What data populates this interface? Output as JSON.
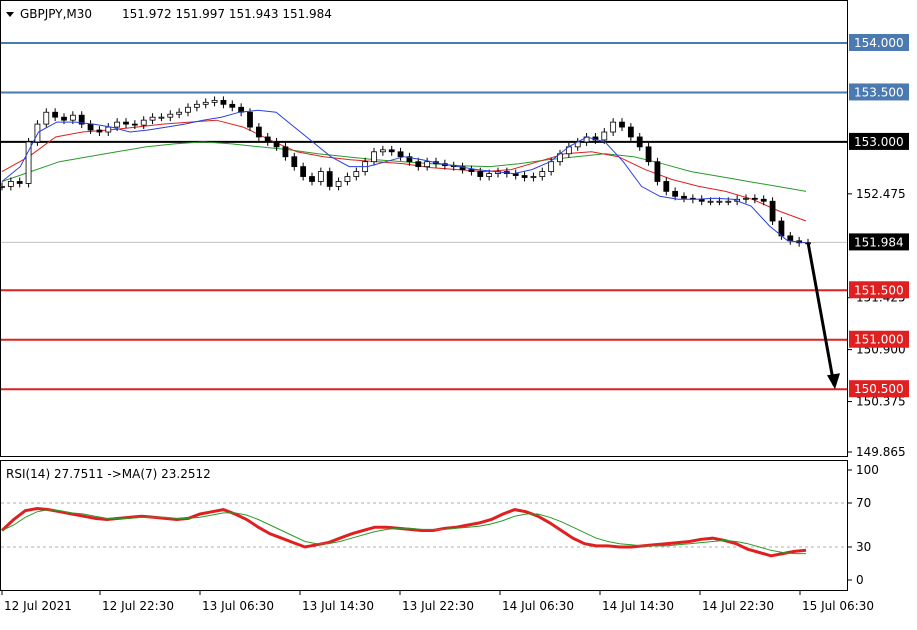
{
  "header": {
    "symbol_label": "GBPJPY,M30",
    "ohlc": "151.972 151.997 151.943 151.984",
    "rsi_label": "RSI(14) 27.7511 ->MA(7) 23.2512"
  },
  "chart_data": {
    "type": "candlestick",
    "symbol": "GBPJPY",
    "timeframe": "M30",
    "open": 151.972,
    "high": 151.997,
    "low": 151.943,
    "close": 151.984,
    "price_ylim": [
      149.75,
      154.25
    ],
    "price_ticks": [
      "154.000",
      "153.500",
      "153.000",
      "152.475",
      "151.984",
      "151.425",
      "150.900",
      "150.375",
      "149.865"
    ],
    "x_ticks": [
      "12 Jul 2021",
      "12 Jul 22:30",
      "13 Jul 06:30",
      "13 Jul 14:30",
      "13 Jul 22:30",
      "14 Jul 06:30",
      "14 Jul 14:30",
      "14 Jul 22:30",
      "15 Jul 06:30"
    ],
    "levels": [
      {
        "label": "154.000",
        "value": 154.0,
        "color": "#4a7ab0",
        "kind": "resistance"
      },
      {
        "label": "153.500",
        "value": 153.5,
        "color": "#4a7ab0",
        "kind": "resistance"
      },
      {
        "label": "153.000",
        "value": 153.0,
        "color": "#000000",
        "kind": "pivot"
      },
      {
        "label": "151.984",
        "value": 151.984,
        "color": "#c0c0c0",
        "kind": "current"
      },
      {
        "label": "151.500",
        "value": 151.5,
        "color": "#e02020",
        "kind": "support"
      },
      {
        "label": "151.000",
        "value": 151.0,
        "color": "#e02020",
        "kind": "support"
      },
      {
        "label": "150.500",
        "value": 150.5,
        "color": "#e02020",
        "kind": "support"
      }
    ],
    "close_series": [
      152.55,
      152.6,
      152.58,
      153.0,
      153.18,
      153.3,
      153.25,
      153.22,
      153.27,
      153.18,
      153.12,
      153.1,
      153.15,
      153.2,
      153.18,
      153.17,
      153.22,
      153.25,
      153.25,
      153.28,
      153.3,
      153.35,
      153.38,
      153.4,
      153.42,
      153.38,
      153.35,
      153.3,
      153.15,
      153.05,
      153.0,
      152.95,
      152.85,
      152.75,
      152.65,
      152.6,
      152.7,
      152.55,
      152.6,
      152.65,
      152.7,
      152.8,
      152.9,
      152.92,
      152.9,
      152.85,
      152.8,
      152.75,
      152.8,
      152.78,
      152.76,
      152.75,
      152.72,
      152.7,
      152.65,
      152.68,
      152.7,
      152.68,
      152.66,
      152.64,
      152.65,
      152.7,
      152.8,
      152.88,
      152.95,
      153.0,
      153.05,
      153.02,
      153.1,
      153.2,
      153.15,
      153.05,
      152.95,
      152.8,
      152.6,
      152.5,
      152.45,
      152.43,
      152.42,
      152.4,
      152.4,
      152.4,
      152.4,
      152.42,
      152.43,
      152.42,
      152.4,
      152.2,
      152.05,
      152.0,
      151.98,
      151.98
    ],
    "ma_fast": [
      152.6,
      152.75,
      153.1,
      153.2,
      153.2,
      153.18,
      153.15,
      153.1,
      153.12,
      153.15,
      153.18,
      153.22,
      153.25,
      153.3,
      153.32,
      153.3,
      153.15,
      153.0,
      152.85,
      152.75,
      152.75,
      152.8,
      152.85,
      152.82,
      152.78,
      152.75,
      152.72,
      152.7,
      152.68,
      152.72,
      152.8,
      152.95,
      153.05,
      153.0,
      152.8,
      152.55,
      152.45,
      152.42,
      152.42,
      152.43,
      152.42,
      152.35,
      152.15,
      152.0,
      151.98
    ],
    "ma_mid": [
      152.7,
      152.85,
      153.05,
      153.1,
      153.12,
      153.15,
      153.18,
      153.2,
      153.22,
      153.15,
      153.02,
      152.9,
      152.85,
      152.82,
      152.8,
      152.78,
      152.74,
      152.72,
      152.7,
      152.72,
      152.8,
      152.88,
      152.9,
      152.85,
      152.72,
      152.62,
      152.55,
      152.5,
      152.42,
      152.3,
      152.2
    ],
    "ma_slow": [
      152.6,
      152.7,
      152.8,
      152.85,
      152.9,
      152.95,
      152.98,
      153.0,
      152.98,
      152.95,
      152.92,
      152.88,
      152.85,
      152.82,
      152.8,
      152.78,
      152.76,
      152.75,
      152.78,
      152.82,
      152.85,
      152.88,
      152.85,
      152.78,
      152.7,
      152.65,
      152.6,
      152.55,
      152.5
    ],
    "forecast": {
      "from": 151.984,
      "to": 150.5
    },
    "rsi": {
      "period": 14,
      "value": 27.7511,
      "ma_period": 7,
      "ma_value": 23.2512,
      "levels": [
        70,
        30
      ],
      "ticks": [
        "100",
        "70",
        "30",
        "0"
      ],
      "ylim": [
        0,
        100
      ],
      "values": [
        45,
        55,
        63,
        65,
        64,
        62,
        60,
        58,
        56,
        55,
        56,
        57,
        58,
        57,
        56,
        55,
        56,
        60,
        62,
        64,
        60,
        55,
        48,
        42,
        38,
        34,
        30,
        32,
        34,
        38,
        42,
        45,
        48,
        48,
        47,
        46,
        45,
        45,
        47,
        48,
        50,
        52,
        55,
        60,
        64,
        62,
        58,
        52,
        45,
        38,
        33,
        31,
        31,
        30,
        30,
        31,
        32,
        33,
        34,
        35,
        37,
        38,
        36,
        33,
        28,
        25,
        22,
        24,
        26,
        27
      ],
      "ma_values": [
        45,
        50,
        57,
        62,
        64,
        63,
        61,
        60,
        58,
        56,
        56,
        56,
        57,
        57,
        57,
        56,
        56,
        57,
        59,
        61,
        61,
        59,
        55,
        50,
        45,
        40,
        35,
        33,
        33,
        35,
        38,
        41,
        44,
        46,
        47,
        47,
        46,
        46,
        46,
        47,
        48,
        49,
        51,
        54,
        58,
        60,
        60,
        57,
        53,
        48,
        43,
        38,
        35,
        33,
        32,
        31,
        31,
        31,
        32,
        33,
        34,
        35,
        36,
        35,
        33,
        30,
        27,
        25,
        24,
        24
      ]
    }
  }
}
